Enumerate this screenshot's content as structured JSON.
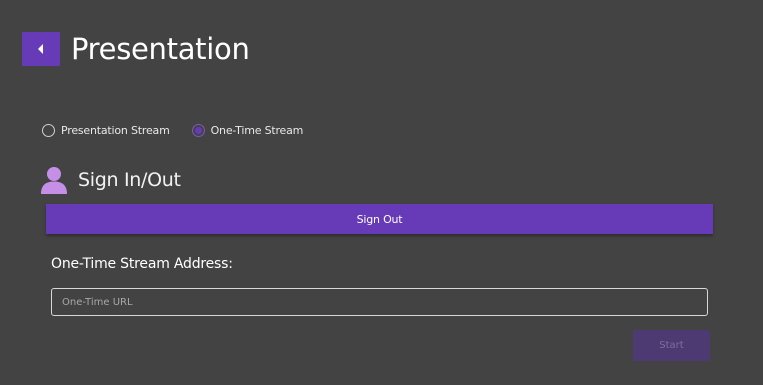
{
  "header": {
    "title": "Presentation",
    "back_icon": "chevron-left-icon"
  },
  "stream_type": {
    "options": [
      {
        "label": "Presentation Stream",
        "selected": false
      },
      {
        "label": "One-Time Stream",
        "selected": true
      }
    ]
  },
  "signin": {
    "icon": "user-icon",
    "title": "Sign In/Out",
    "button_label": "Sign Out"
  },
  "address": {
    "label": "One-Time Stream Address:",
    "placeholder": "One-Time URL",
    "value": ""
  },
  "start": {
    "label": "Start",
    "enabled": false
  },
  "colors": {
    "background": "#434343",
    "accent": "#673ab7",
    "user_icon": "#c58fe8",
    "disabled_button": "#4d3a73"
  }
}
